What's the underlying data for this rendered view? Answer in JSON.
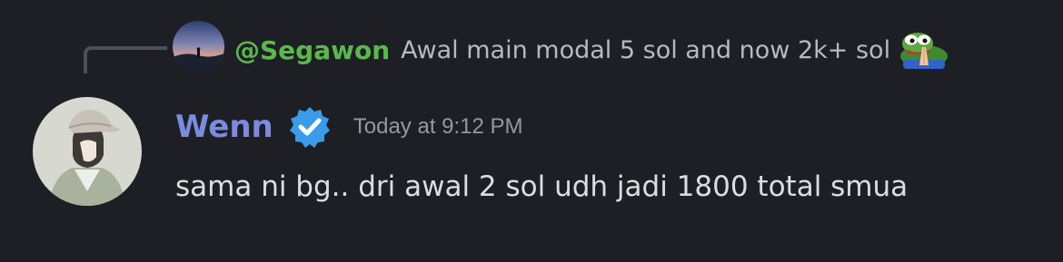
{
  "reply": {
    "author": "@Segawon",
    "text": "Awal main modal 5 sol and now 2k+ sol",
    "emoji": "pepe-pray-emoji",
    "avatar": "sunset-silhouette-avatar"
  },
  "message": {
    "author": "Wenn",
    "badge": "verified-badge-icon",
    "timestamp": "Today at 9:12 PM",
    "text": "sama ni bg.. dri awal 2 sol udh jadi 1800 total smua",
    "avatar": "cap-boy-avatar"
  },
  "colors": {
    "background": "#1e1f24",
    "reply_author": "#5ab84e",
    "author": "#7a8be0",
    "verified": "#3a9be8",
    "muted_text": "#b5bac1",
    "body_text": "#dbdee1",
    "timestamp": "#9598a1"
  }
}
